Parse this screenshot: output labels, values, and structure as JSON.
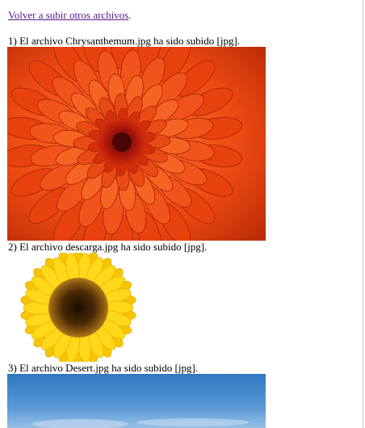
{
  "back_link": {
    "text": "Volver a subir otros archivos",
    "suffix": "."
  },
  "files": [
    {
      "text": "1) El archivo Chrysanthemum.jpg ha sido subido [jpg].",
      "image": "chrysanthemum-image"
    },
    {
      "text": "2) El archivo descarga.jpg ha sido subido [jpg].",
      "image": "sunflower-image"
    },
    {
      "text": "3) El archivo Desert.jpg ha sido subido [jpg].",
      "image": "desert-sky-image"
    }
  ],
  "colors": {
    "link_visited": "#551a8b",
    "flower_orange": "#e8420f",
    "sunflower_yellow": "#fcd307",
    "sky_blue": "#3e86c8"
  }
}
